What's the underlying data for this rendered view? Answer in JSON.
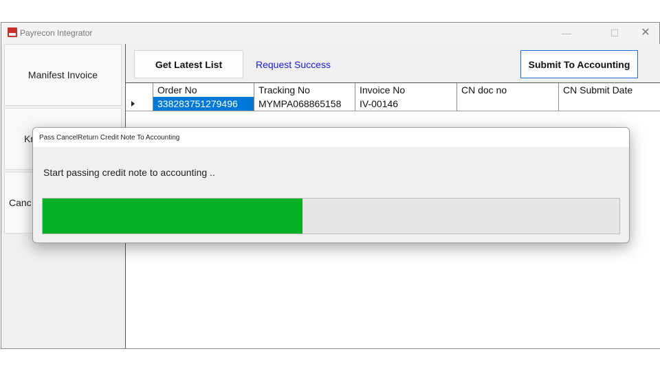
{
  "window": {
    "title": "Payrecon Integrator",
    "controls": {
      "minimize": "—",
      "maximize": "☐",
      "close": "✕"
    }
  },
  "sidebar": {
    "items": [
      {
        "label": "Manifest Invoice"
      },
      {
        "label": "Kr"
      },
      {
        "label": "Canc"
      }
    ]
  },
  "toolbar": {
    "get_latest_label": "Get Latest List",
    "status_text": "Request Success",
    "submit_label": "Submit To Accounting",
    "status_color": "#1a1ae6",
    "accent_color": "#1f6bd1"
  },
  "grid": {
    "columns": [
      "Order No",
      "Tracking No",
      "Invoice No",
      "CN doc no",
      "CN Submit Date"
    ],
    "rows": [
      [
        "338283751279496",
        "MYMPA068865158",
        "IV-00146",
        "",
        ""
      ]
    ],
    "selection_color": "#0078d7"
  },
  "dialog": {
    "title": "Pass CancelReturn Credit Note To Accounting",
    "message": "Start passing credit note to accounting ..",
    "progress": 0.45,
    "progress_color": "#06b025"
  }
}
